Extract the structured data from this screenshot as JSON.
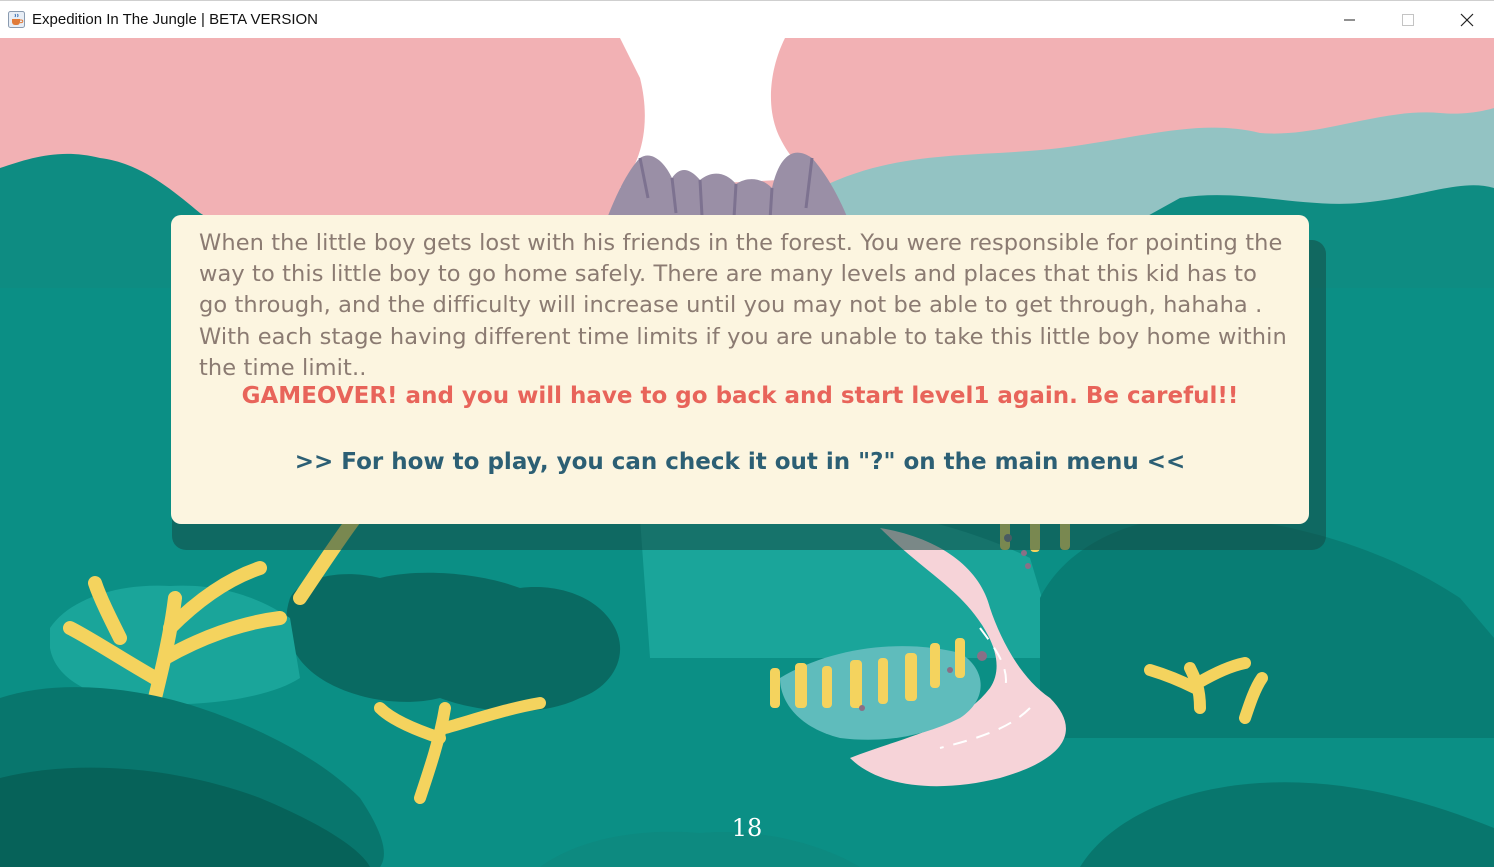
{
  "window": {
    "title": "Expedition In The Jungle | BETA VERSION",
    "app_icon": "java-cup-icon",
    "controls": [
      "minimize-icon",
      "maximize-icon",
      "close-icon"
    ]
  },
  "intro": {
    "story": "When the little boy gets lost with his friends in the forest. You were responsible for pointing the way to this little boy to go home safely. There are many levels and places that this kid has to go through, and the difficulty will increase until you may not be able to get through, hahaha . With each stage having different time limits if you are unable to take this little boy home within the time limit..",
    "warning": "GAMEOVER! and you will have to go back and start level1 again. Be careful!!",
    "howto": ">> For how to play, you can check it out in \"?\" on the main menu <<"
  },
  "timer": {
    "value": "18"
  },
  "colors": {
    "sky": "#f2b1b4",
    "panel": "#fcf5e0",
    "story_text": "#8b7b72",
    "warning_text": "#e8645a",
    "howto_text": "#2c5f74",
    "forest": "#0e8c82"
  }
}
